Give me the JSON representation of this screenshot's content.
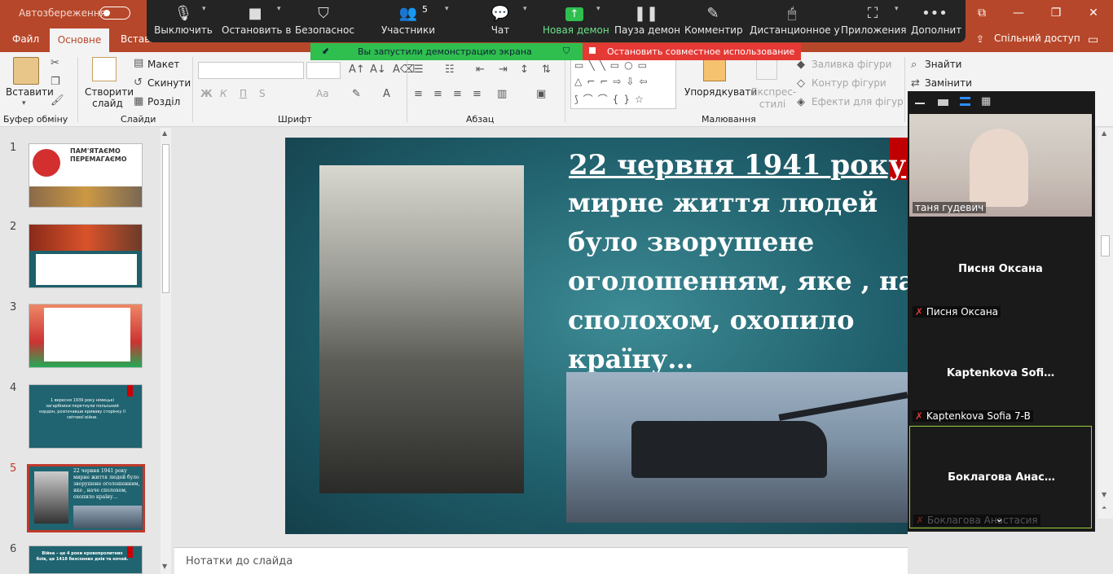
{
  "titlebar": {
    "autosave": "Автозбереження",
    "minimize": "—",
    "restore": "❐",
    "close": "✕",
    "restore_down": "⧉"
  },
  "tabs": {
    "file": "Файл",
    "home": "Основне",
    "insert": "Вставл",
    "share": "Спільний доступ"
  },
  "zoom_toolbar": {
    "items": [
      {
        "label": "Выключить",
        "icon": "microphone-icon"
      },
      {
        "label": "Остановить в",
        "icon": "video-camera-icon"
      },
      {
        "label": "Безопаснос",
        "icon": "shield-icon"
      },
      {
        "label": "Участники",
        "icon": "participants-icon",
        "count": "5"
      },
      {
        "label": "Чат",
        "icon": "chat-icon"
      },
      {
        "label": "Новая демон",
        "icon": "share-screen-icon"
      },
      {
        "label": "Пауза демон",
        "icon": "pause-icon"
      },
      {
        "label": "Комментир",
        "icon": "pen-icon"
      },
      {
        "label": "Дистанционное у",
        "icon": "mouse-icon"
      },
      {
        "label": "Приложения",
        "icon": "apps-icon"
      },
      {
        "label": "Дополнит",
        "icon": "more-icon"
      }
    ],
    "green_banner": "Вы запустили демонстрацию экрана",
    "red_banner": "Остановить совместное использование"
  },
  "ribbon": {
    "clipboard": {
      "paste": "Вставити",
      "label": "Буфер обміну"
    },
    "slides": {
      "new_slide": "Створити слайд",
      "layout": "Макет",
      "reset": "Скинути",
      "section": "Розділ",
      "label": "Слайди"
    },
    "font": {
      "label": "Шрифт",
      "bold": "Ж",
      "italic": "К",
      "underline": "П",
      "strike": "S",
      "case": "Aa"
    },
    "paragraph": {
      "label": "Абзац"
    },
    "drawing": {
      "arrange": "Упорядкувати",
      "styles": "Експрес-стилі",
      "fill": "Заливка фігури",
      "outline": "Контур фігури",
      "effects": "Ефекти для фігур",
      "label": "Малювання"
    },
    "editing": {
      "find": "Знайти",
      "replace": "Замінити"
    }
  },
  "thumbnails": {
    "numbers": [
      "1",
      "2",
      "3",
      "4",
      "5",
      "6"
    ],
    "slide1": {
      "line1": "ПАМ'ЯТАЄМО",
      "line2": "ПЕРЕМАГАЄМО"
    },
    "slide4": {
      "text": "1 вересня 1939 року німецькі загарбники перетнули польський кордон, розпочавши криваву сторінку II світової війни."
    },
    "slide5": {
      "text": "22 червня 1941 року мирне життя людей було зворушене оголошенням, яке , наче сполохом, охопило країну…"
    },
    "slide6": {
      "text": "Війна – це 4 роки кровопролитних боїв, це 1418 безсонних днів та ночей."
    }
  },
  "slide": {
    "title": "22 червня 1941 року",
    "body": "мирне життя людей\nбуло зворушене\nоголошенням, яке , нач\nсполохом, охопило\nкраїну…"
  },
  "notes": {
    "placeholder": "Нотатки до слайда"
  },
  "participants": {
    "tile1": {
      "label": "таня гудевич"
    },
    "tile2": {
      "name": "Писня Оксана",
      "label": "Писня Оксана"
    },
    "tile3": {
      "name": "Kaptenkova  Sofi…",
      "label": "Kaptenkova Sofia 7-B"
    },
    "tile4": {
      "name": "Боклагова  Анас…",
      "label": "Боклагова Анастасия"
    }
  },
  "colors": {
    "powerpoint_accent": "#b7472a",
    "zoom_dark": "#242424",
    "banner_green": "#2ebf4f",
    "banner_red": "#e53935",
    "active_tile_border": "#9bd13b"
  }
}
